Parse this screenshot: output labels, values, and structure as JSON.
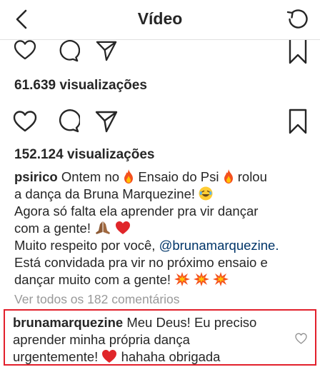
{
  "header": {
    "title": "Vídeo",
    "back_icon": "chevron-left-icon",
    "refresh_icon": "refresh-icon"
  },
  "post_previous": {
    "views": "61.639 visualizações",
    "icons": [
      "heart-icon",
      "comment-icon",
      "share-icon",
      "bookmark-icon"
    ]
  },
  "post": {
    "views": "152.124 visualizações",
    "icons": [
      "heart-icon",
      "comment-icon",
      "share-icon",
      "bookmark-icon"
    ],
    "caption": {
      "username": "psirico",
      "line1_a": "Ontem no",
      "line1_b": "Ensaio do Psi",
      "line1_c": "rolou",
      "line2": "a dança da Bruna Marquezine!",
      "line3": "Agora só falta ela aprender pra vir dançar",
      "line4": "com a gente!",
      "line5_a": "Muito respeito por você,",
      "line5_mention": "@brunamarquezine.",
      "line6": "Está convidada pra vir no próximo ensaio e",
      "line7": "dançar muito com a gente!"
    },
    "view_all_comments": "Ver todos os 182 comentários"
  },
  "highlighted_comment": {
    "username": "brunamarquezine",
    "line1": "Meu Deus! Eu preciso",
    "line2": "aprender minha própria dança",
    "line3_a": "urgentemente!",
    "line3_b": "hahaha obrigada",
    "like_icon": "heart-outline-icon"
  },
  "colors": {
    "text": "#262626",
    "muted": "#999999",
    "mention": "#003569",
    "highlight_border": "#e2202c",
    "heart_red": "#e0262a"
  }
}
